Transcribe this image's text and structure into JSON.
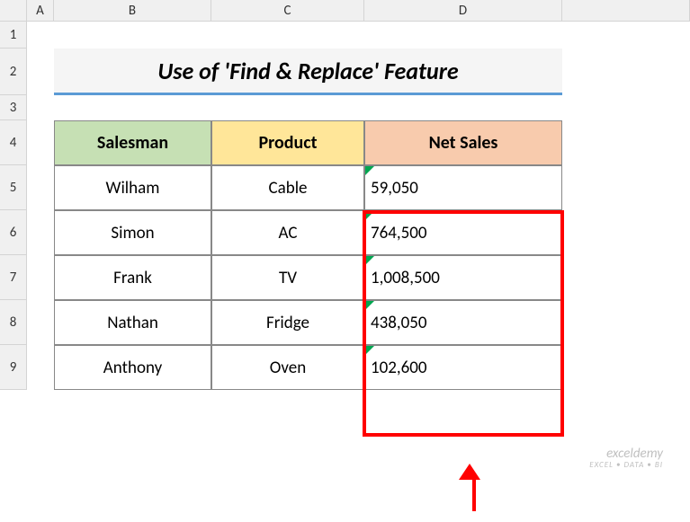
{
  "columns": [
    "A",
    "B",
    "C",
    "D"
  ],
  "rows": [
    "1",
    "2",
    "3",
    "4",
    "5",
    "6",
    "7",
    "8",
    "9"
  ],
  "title": "Use of 'Find & Replace' Feature",
  "headers": {
    "salesman": "Salesman",
    "product": "Product",
    "netsales": "Net Sales"
  },
  "chart_data": {
    "type": "table",
    "columns": [
      "Salesman",
      "Product",
      "Net Sales"
    ],
    "rows": [
      {
        "salesman": "Wilham",
        "product": "Cable",
        "netsales": "59,050"
      },
      {
        "salesman": "Simon",
        "product": "AC",
        "netsales": "764,500"
      },
      {
        "salesman": "Frank",
        "product": "TV",
        "netsales": "1,008,500"
      },
      {
        "salesman": "Nathan",
        "product": "Fridge",
        "netsales": "438,050"
      },
      {
        "salesman": "Anthony",
        "product": "Oven",
        "netsales": "102,600"
      }
    ]
  },
  "watermark": {
    "main": "exceldemy",
    "sub": "EXCEL • DATA • BI"
  }
}
